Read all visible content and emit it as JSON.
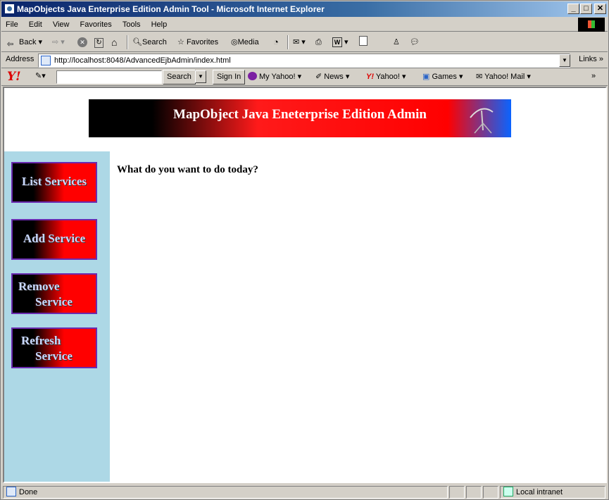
{
  "window": {
    "title": "MapObjects Java Enterprise Edition Admin Tool - Microsoft Internet Explorer",
    "minimize": "_",
    "maximize": "□",
    "close": "✕"
  },
  "menu": [
    "File",
    "Edit",
    "View",
    "Favorites",
    "Tools",
    "Help"
  ],
  "toolbar": {
    "back": "Back",
    "search": "Search",
    "favorites": "Favorites",
    "media": "Media"
  },
  "address": {
    "label": "Address",
    "url": "http://localhost:8048/AdvancedEjbAdmin/index.html",
    "links": "Links"
  },
  "yahoo_bar": {
    "logo": "Y!",
    "search_button": "Search",
    "sign_in": "Sign In",
    "my_yahoo": "My Yahoo!",
    "news": "News",
    "yahoo": "Yahoo!",
    "games": "Games",
    "yahoo_mail": "Yahoo! Mail",
    "more": "»"
  },
  "page": {
    "banner_title": "MapObject Java Eneterprise Edition Admin",
    "question": "What do you want to do today?",
    "nav": [
      {
        "line1": "List Services"
      },
      {
        "line1": "Add Service"
      },
      {
        "line1": "Remove",
        "line2": "Service"
      },
      {
        "line1": "Refresh",
        "line2": "Service"
      }
    ]
  },
  "status": {
    "text": "Done",
    "zone": "Local intranet"
  },
  "colors": {
    "titlebar": "#0a246a",
    "sidebar": "#add8e6",
    "banner_red": "#ff0000",
    "nav_border": "#6a2bb0"
  }
}
